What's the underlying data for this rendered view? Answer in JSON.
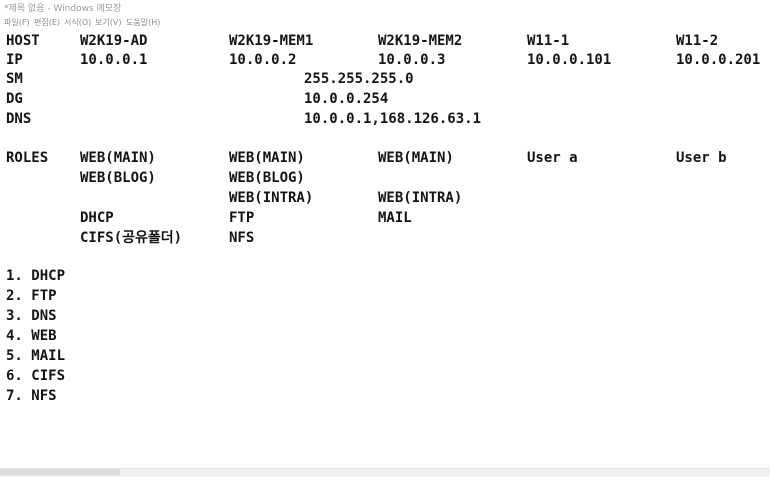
{
  "window": {
    "title": "*제목 없음 - Windows 메모장"
  },
  "menu": [
    "파일(F)",
    "편집(E)",
    "서식(O)",
    "보기(V)",
    "도움말(H)"
  ],
  "rows": {
    "host": [
      "HOST",
      "W2K19-AD",
      "W2K19-MEM1",
      "W2K19-MEM2",
      "W11-1",
      "W11-2"
    ],
    "ip": [
      "IP",
      "10.0.0.1",
      "10.0.0.2",
      "10.0.0.3",
      "10.0.0.101",
      "10.0.0.201"
    ],
    "sm": [
      "SM",
      "255.255.255.0"
    ],
    "dg": [
      "DG",
      "10.0.0.254"
    ],
    "dns": [
      "DNS",
      "10.0.0.1,168.126.63.1"
    ],
    "roles1": [
      "ROLES",
      "WEB(MAIN)",
      "WEB(MAIN)",
      "WEB(MAIN)",
      "User a",
      "User b"
    ],
    "roles2": [
      "WEB(BLOG)",
      "WEB(BLOG)"
    ],
    "roles3": [
      "WEB(INTRA)",
      "WEB(INTRA)"
    ],
    "roles4": [
      "DHCP",
      "FTP",
      "MAIL"
    ],
    "roles5": [
      "CIFS(공유폴더)",
      "NFS"
    ]
  },
  "list": [
    "1. DHCP",
    "2. FTP",
    "3. DNS",
    "4. WEB",
    "5. MAIL",
    "6. CIFS",
    "7. NFS"
  ]
}
